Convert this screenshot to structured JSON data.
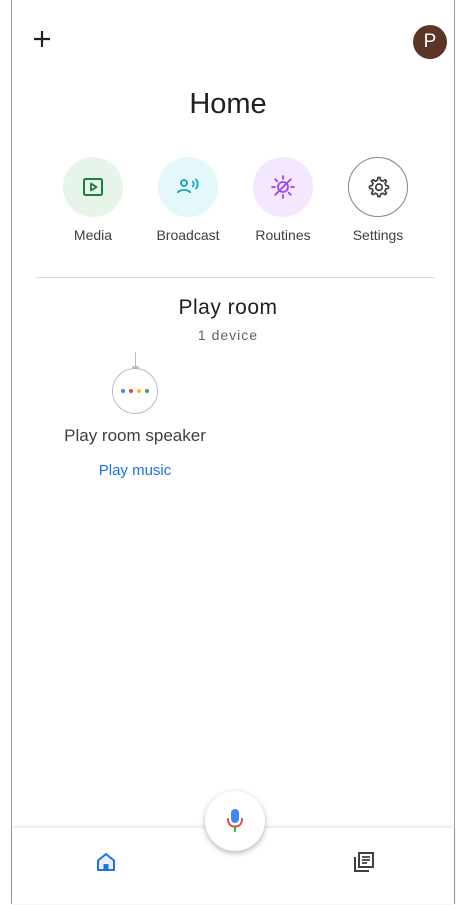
{
  "header": {
    "add_icon": "plus-icon",
    "avatar_initial": "P",
    "title": "Home"
  },
  "actions": [
    {
      "label": "Media",
      "icon": "media-icon",
      "bg": "#e6f4ea",
      "fg": "#188038"
    },
    {
      "label": "Broadcast",
      "icon": "broadcast-icon",
      "bg": "#e4f7fb",
      "fg": "#12a4b7"
    },
    {
      "label": "Routines",
      "icon": "routines-icon",
      "bg": "#f3e8fd",
      "fg": "#a142f4"
    },
    {
      "label": "Settings",
      "icon": "gear-icon",
      "bg": "#ffffff",
      "fg": "#3c4043"
    }
  ],
  "room": {
    "name": "Play room",
    "device_count": "1 device"
  },
  "device": {
    "name": "Play room speaker",
    "action_label": "Play music",
    "icon": "speaker-icon",
    "dot_colors": [
      "#4285f4",
      "#ea4335",
      "#fbbc04",
      "#34a853"
    ]
  },
  "bottom_nav": {
    "left": "home-icon",
    "center": "mic-icon",
    "right": "feed-icon"
  }
}
